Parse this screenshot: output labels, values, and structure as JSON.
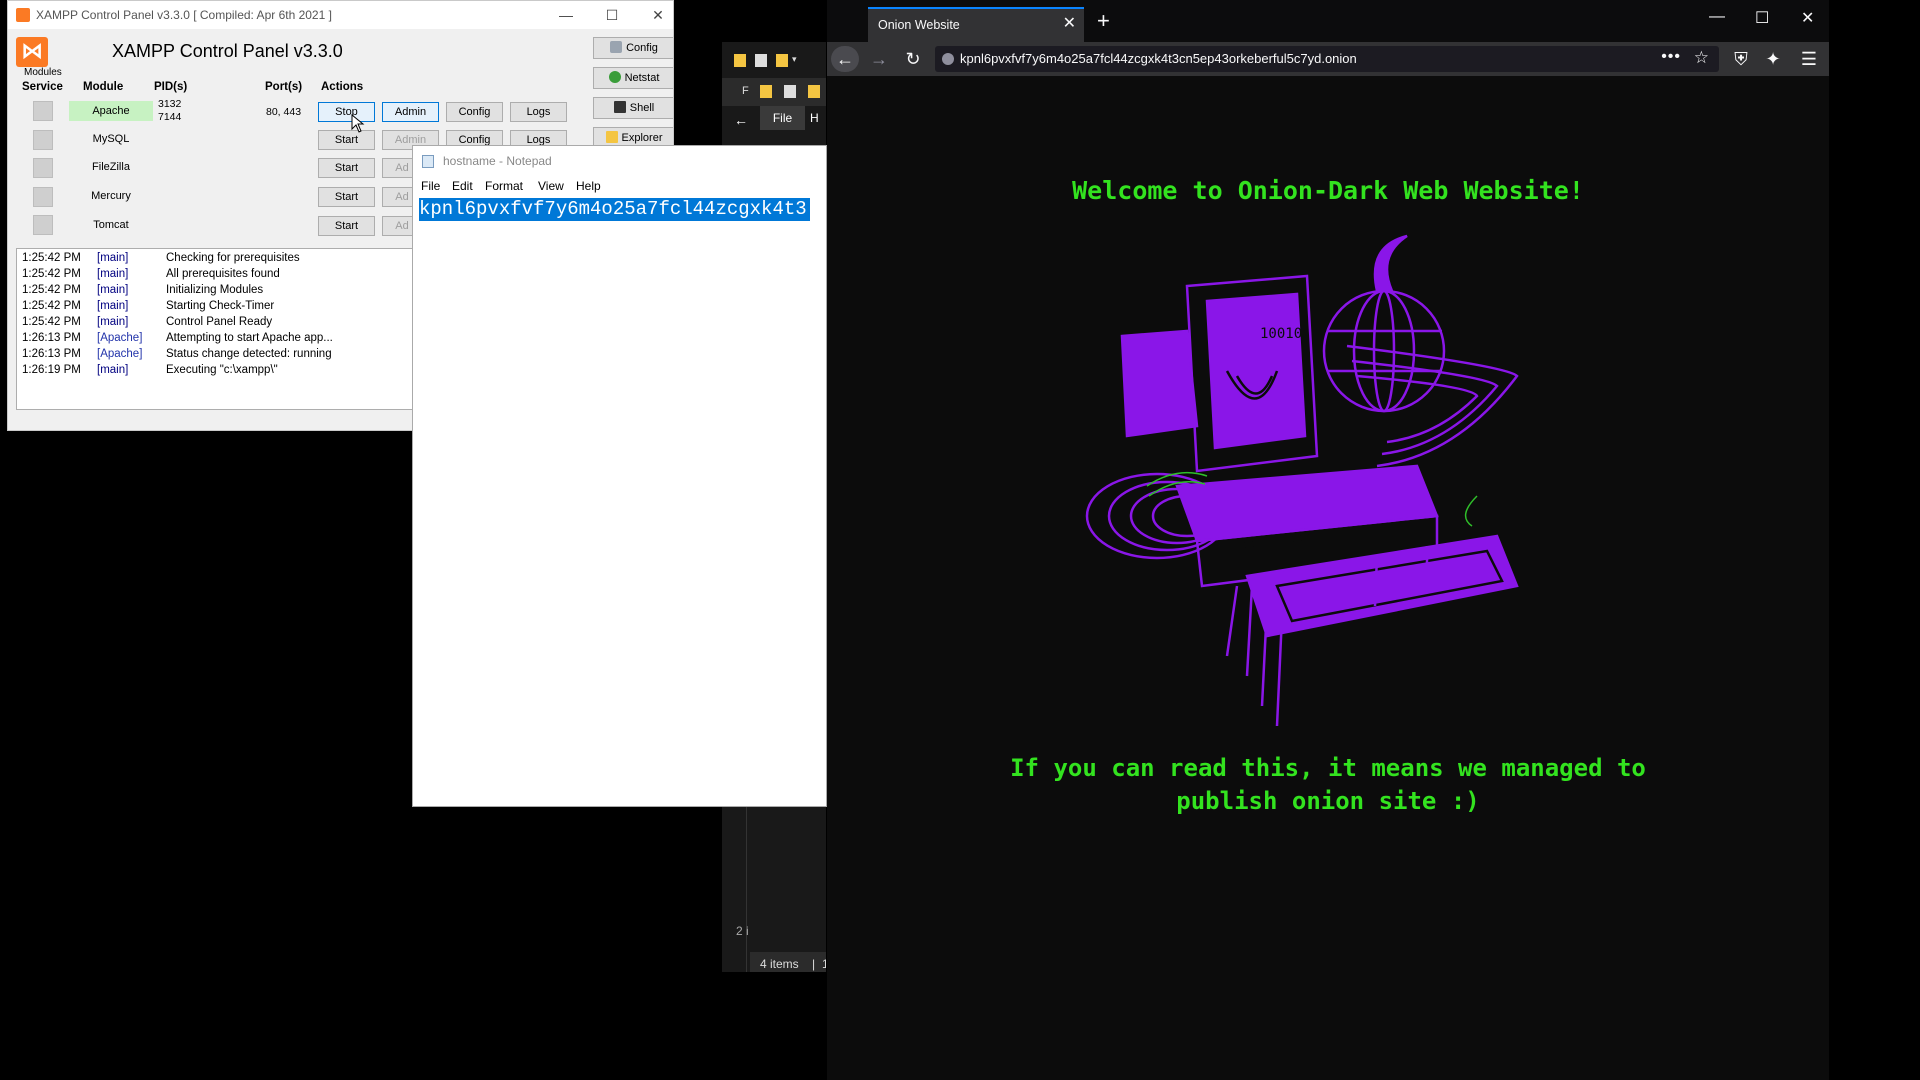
{
  "xampp": {
    "window_title": "XAMPP Control Panel v3.3.0   [ Compiled: Apr 6th 2021 ]",
    "title": "XAMPP Control Panel v3.3.0",
    "modules_label": "Modules",
    "headers": {
      "service": "Service",
      "module": "Module",
      "pids": "PID(s)",
      "ports": "Port(s)",
      "actions": "Actions"
    },
    "modules": [
      {
        "name": "Apache",
        "pid1": "3132",
        "pid2": "7144",
        "ports": "80, 443",
        "action": "Stop",
        "admin": "Admin",
        "config": "Config",
        "logs": "Logs"
      },
      {
        "name": "MySQL",
        "pid1": "",
        "pid2": "",
        "ports": "",
        "action": "Start",
        "admin": "Admin",
        "config": "Config",
        "logs": "Logs"
      },
      {
        "name": "FileZilla",
        "action": "Start",
        "admin": "Ad"
      },
      {
        "name": "Mercury",
        "action": "Start",
        "admin": "Ad"
      },
      {
        "name": "Tomcat",
        "action": "Start",
        "admin": "Ad"
      }
    ],
    "side_buttons": {
      "config": "Config",
      "netstat": "Netstat",
      "shell": "Shell",
      "explorer": "Explorer"
    },
    "log": [
      {
        "time": "1:25:42 PM",
        "source": "[main]",
        "msg": "Checking for prerequisites"
      },
      {
        "time": "1:25:42 PM",
        "source": "[main]",
        "msg": "All prerequisites found"
      },
      {
        "time": "1:25:42 PM",
        "source": "[main]",
        "msg": "Initializing Modules"
      },
      {
        "time": "1:25:42 PM",
        "source": "[main]",
        "msg": "Starting Check-Timer"
      },
      {
        "time": "1:25:42 PM",
        "source": "[main]",
        "msg": "Control Panel Ready"
      },
      {
        "time": "1:26:13 PM",
        "source": "[Apache]",
        "msg": "Attempting to start Apache app..."
      },
      {
        "time": "1:26:13 PM",
        "source": "[Apache]",
        "msg": "Status change detected: running"
      },
      {
        "time": "1:26:19 PM",
        "source": "[main]",
        "msg": "Executing \"c:\\xampp\\\""
      }
    ]
  },
  "explorer": {
    "tab_file": "File",
    "tab_h": "H",
    "status_items": "4 items",
    "status_sep": "|",
    "status_partial": "1",
    "side_partial": "2 i",
    "f_partial": "F"
  },
  "notepad": {
    "title": "hostname - Notepad",
    "menu": [
      "File",
      "Edit",
      "Format",
      "View",
      "Help"
    ],
    "text": "kpnl6pvxfvf7y6m4o25a7fcl44zcgxk4t3"
  },
  "browser": {
    "tab_title": "Onion Website",
    "url": "kpnl6pvxfvf7y6m4o25a7fcl44zcgxk4t3cn5ep43orkeberful5c7yd.onion",
    "heading": "Welcome to Onion-Dark Web Website!",
    "footer_line1": "If you can read this, it means we managed to",
    "footer_line2": "publish onion site :)",
    "art_text": "10010",
    "colors": {
      "green": "#33e31f",
      "purple": "#8a16e8",
      "accent": "#0a84ff"
    }
  },
  "icons": [
    "xampp-logo-icon",
    "minimize-icon",
    "maximize-icon",
    "close-icon",
    "wrench-icon",
    "globe-icon",
    "terminal-icon",
    "folder-icon",
    "notepad-icon",
    "back-arrow-icon",
    "forward-arrow-icon",
    "reload-icon",
    "info-icon",
    "more-icon",
    "star-icon",
    "shield-icon",
    "sparkle-icon",
    "hamburger-menu-icon",
    "plus-icon"
  ]
}
